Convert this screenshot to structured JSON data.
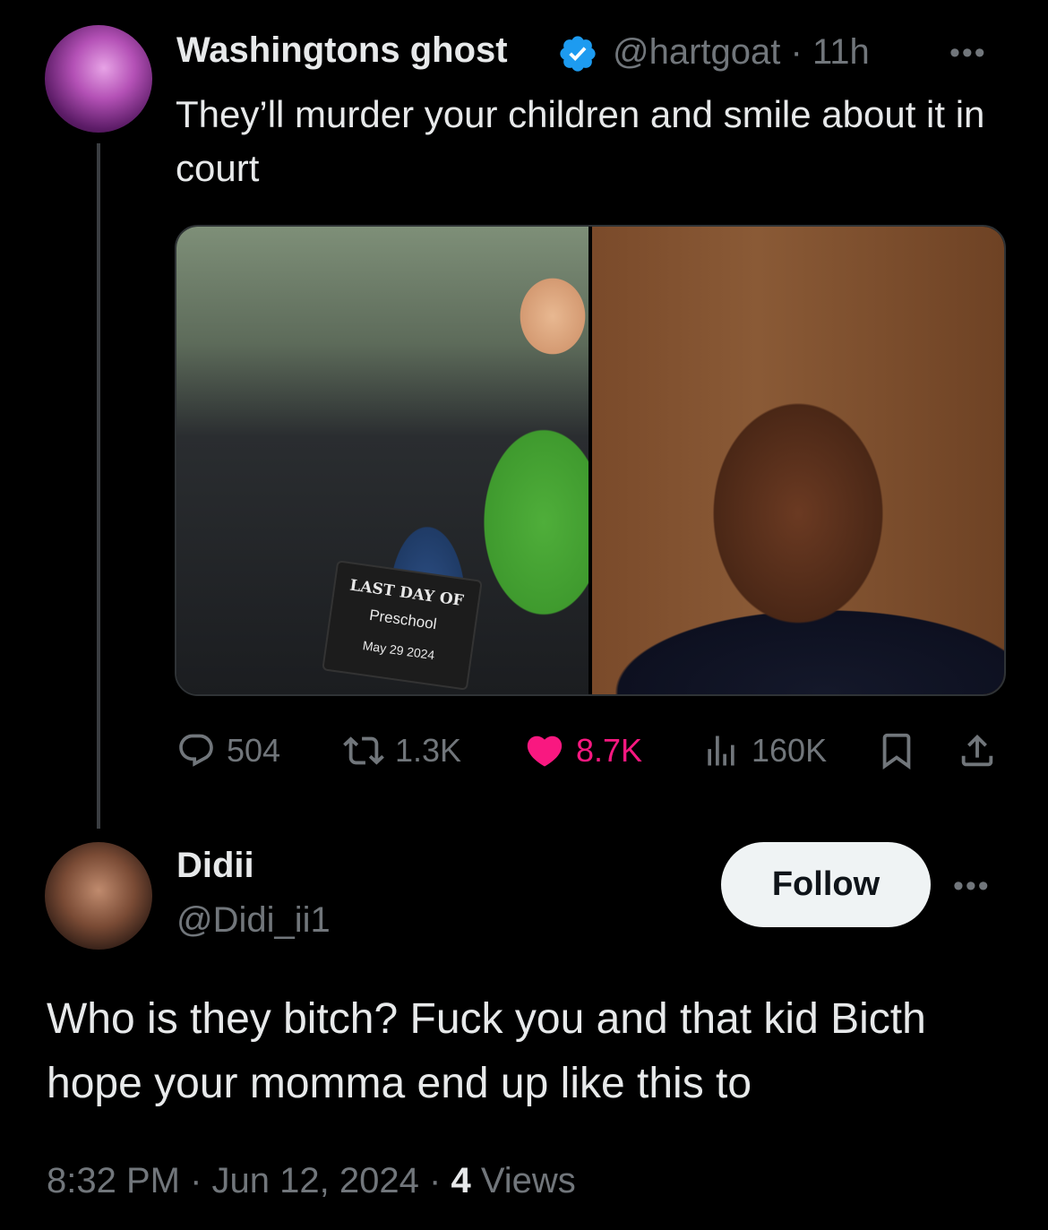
{
  "original_tweet": {
    "author_name": "Washingtons ghost",
    "handle": "@hartgoat",
    "separator": "·",
    "time_ago": "11h",
    "text": "They’ll murder your children and smile about it in court",
    "more_icon": "more-horizontal-icon",
    "stats": {
      "replies": "504",
      "retweets": "1.3K",
      "likes": "8.7K",
      "views": "160K"
    },
    "media": {
      "sign_line1": "LAST DAY OF",
      "sign_line2": "Preschool",
      "sign_date": "May 29 2024"
    }
  },
  "reply": {
    "author_name": "Didii",
    "handle": "@Didi_ii1",
    "follow_label": "Follow",
    "text": "Who is they bitch? Fuck you and that kid Bicth hope your momma end up like this to",
    "time": "8:32 PM",
    "separator": "·",
    "date": "Jun 12, 2024",
    "views_count": "4",
    "views_label": "Views"
  },
  "colors": {
    "background": "#000000",
    "text_primary": "#e7e9ea",
    "text_secondary": "#71767b",
    "like_pink": "#f91880",
    "verified_blue": "#1d9bf0"
  }
}
